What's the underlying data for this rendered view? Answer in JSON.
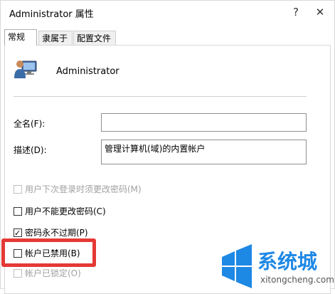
{
  "window": {
    "title": "Administrator 属性",
    "help_symbol": "?",
    "close_symbol": "✕"
  },
  "tabs": [
    {
      "label": "常规",
      "active": true
    },
    {
      "label": "隶属于",
      "active": false
    },
    {
      "label": "配置文件",
      "active": false
    }
  ],
  "general": {
    "username": "Administrator",
    "fullname_label": "全名(F):",
    "fullname_value": "",
    "description_label": "描述(D):",
    "description_value": "管理计算机(域)的内置帐户"
  },
  "options": [
    {
      "label": "用户下次登录时须更改密码(M)",
      "checked": false,
      "disabled": true
    },
    {
      "label": "用户不能更改密码(C)",
      "checked": false,
      "disabled": false
    },
    {
      "label": "密码永不过期(P)",
      "checked": true,
      "disabled": false
    },
    {
      "label": "帐户已禁用(B)",
      "checked": false,
      "disabled": false
    },
    {
      "label": "帐户已锁定(O)",
      "checked": false,
      "disabled": true
    }
  ],
  "watermark": {
    "brand": "系统城",
    "url": "xitongcheng.com"
  },
  "colors": {
    "highlight": "#e53935",
    "watermark_blue": "#1e88e5"
  }
}
